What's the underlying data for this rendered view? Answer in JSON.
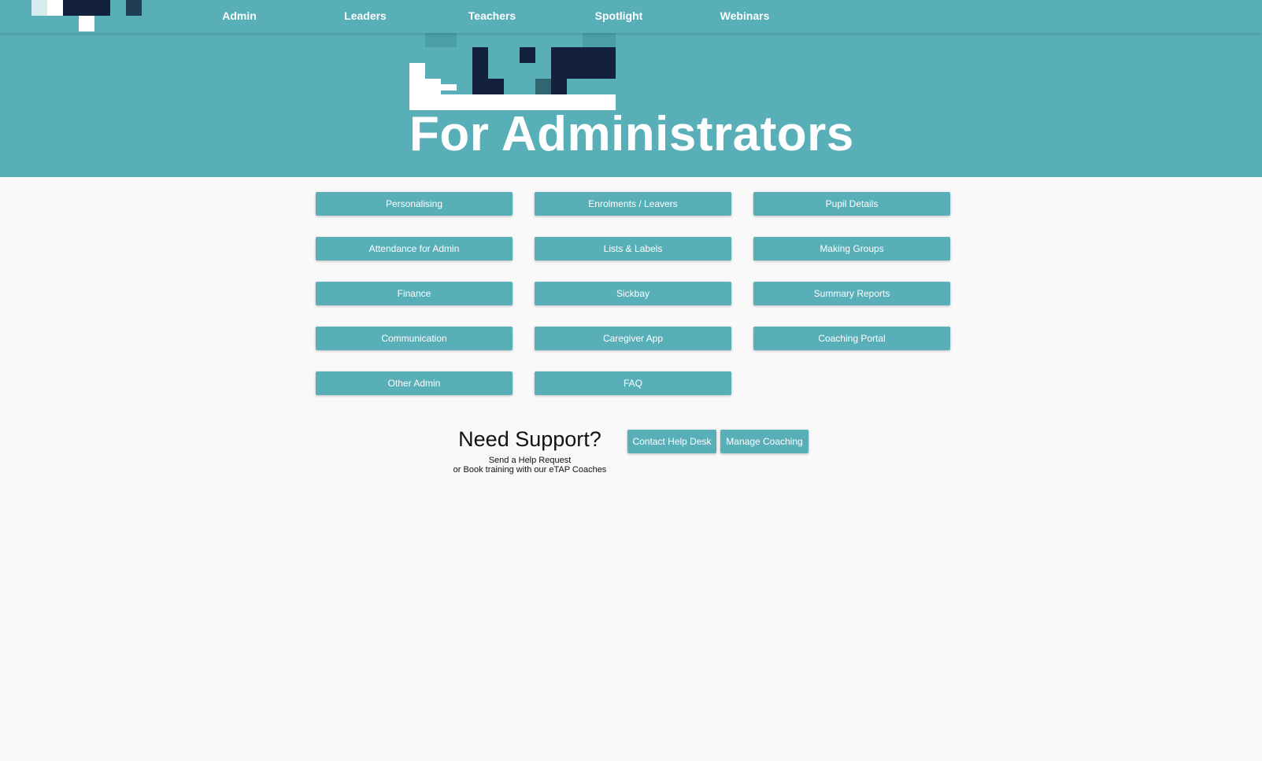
{
  "nav": {
    "items": [
      "Admin",
      "Leaders",
      "Teachers",
      "Spotlight",
      "Webinars"
    ]
  },
  "hero": {
    "title": "For Administrators"
  },
  "topics": [
    "Personalising",
    "Enrolments / Leavers",
    "Pupil Details",
    "Attendance for Admin",
    "Lists & Labels",
    "Making Groups",
    "Finance",
    "Sickbay",
    "Summary Reports",
    "Communication",
    "Caregiver App",
    "Coaching Portal",
    "Other Admin",
    "FAQ"
  ],
  "support": {
    "title": "Need Support?",
    "line1": "Send a Help Request",
    "line2": "or Book training with our eTAP Coaches",
    "contact_label": "Contact Help Desk",
    "coaching_label": "Manage Coaching"
  },
  "colors": {
    "brand": "#58afb8",
    "dark": "#13213c",
    "background": "#f9f9f9"
  }
}
